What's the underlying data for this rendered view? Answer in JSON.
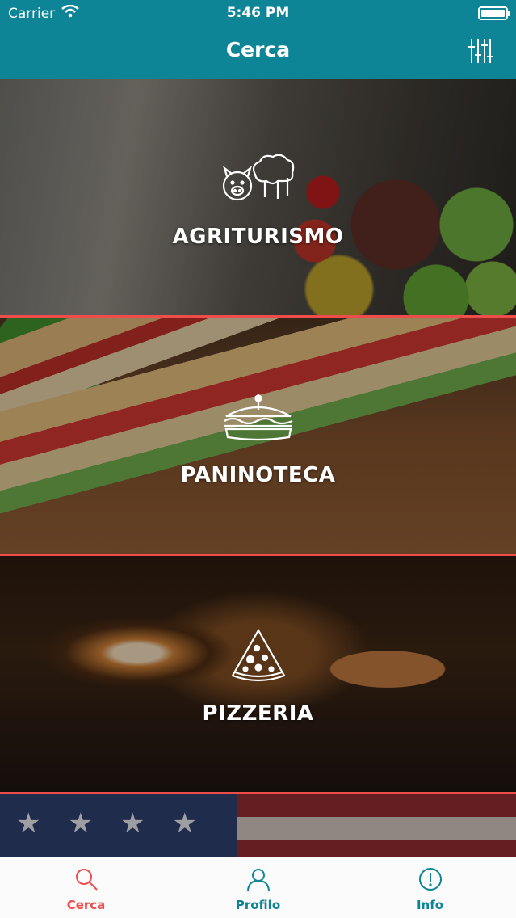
{
  "status_bar": {
    "carrier": "Carrier",
    "time": "5:46 PM"
  },
  "nav": {
    "title": "Cerca",
    "filter_icon": "sliders-icon"
  },
  "categories": [
    {
      "label": "AGRITURISMO",
      "icon": "farm-pig-trees-icon"
    },
    {
      "label": "PANINOTECA",
      "icon": "sandwich-icon"
    },
    {
      "label": "PIZZERIA",
      "icon": "pizza-slice-icon"
    },
    {
      "label": "",
      "icon": ""
    }
  ],
  "tabs": [
    {
      "label": "Cerca",
      "icon": "search-icon",
      "active": true
    },
    {
      "label": "Profilo",
      "icon": "user-icon",
      "active": false
    },
    {
      "label": "Info",
      "icon": "info-icon",
      "active": false
    }
  ],
  "colors": {
    "primary": "#0e8596",
    "accent": "#ef4c4c",
    "tab_inactive": "#0e8596",
    "tab_active": "#ef4c4c"
  }
}
